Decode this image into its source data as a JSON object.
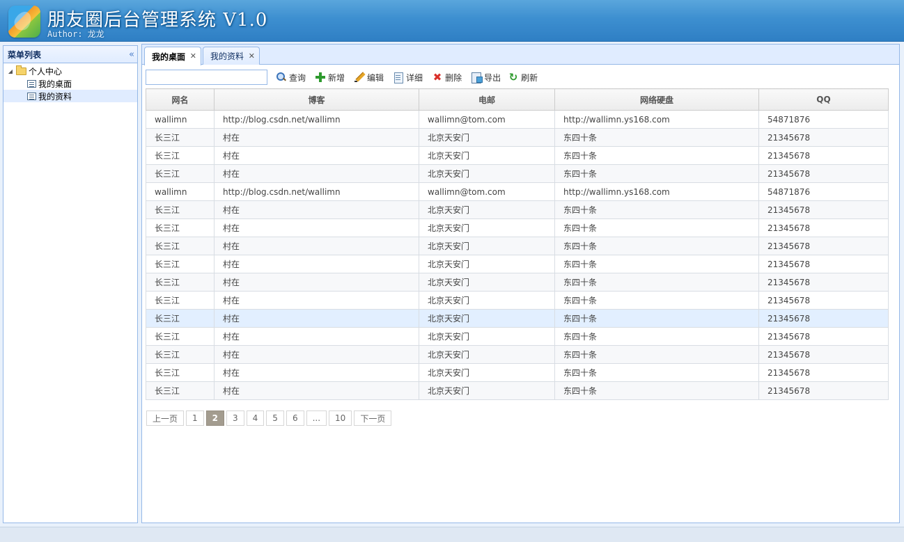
{
  "header": {
    "title": "朋友圈后台管理系统 V1.0",
    "author": "Author: 龙龙",
    "logo_icon": "leaf-logo-icon"
  },
  "sidebar": {
    "title": "菜单列表",
    "collapse_icon": "double-chevron-left-icon",
    "tree": {
      "root_label": "个人中心",
      "items": [
        {
          "label": "我的桌面",
          "selected": false
        },
        {
          "label": "我的资料",
          "selected": true
        }
      ]
    }
  },
  "tabs": [
    {
      "label": "我的桌面",
      "active": true
    },
    {
      "label": "我的资料",
      "active": false
    }
  ],
  "toolbar": {
    "search_value": "",
    "search_label": "查询",
    "add_label": "新增",
    "edit_label": "编辑",
    "detail_label": "详细",
    "delete_label": "删除",
    "export_label": "导出",
    "refresh_label": "刷新"
  },
  "table": {
    "columns": [
      "网名",
      "博客",
      "电邮",
      "网络硬盘",
      "QQ"
    ],
    "rows": [
      [
        "wallimn",
        "http://blog.csdn.net/wallimn",
        "wallimn@tom.com",
        "http://wallimn.ys168.com",
        "54871876"
      ],
      [
        "长三江",
        "村在",
        "北京天安门",
        "东四十条",
        "21345678"
      ],
      [
        "长三江",
        "村在",
        "北京天安门",
        "东四十条",
        "21345678"
      ],
      [
        "长三江",
        "村在",
        "北京天安门",
        "东四十条",
        "21345678"
      ],
      [
        "wallimn",
        "http://blog.csdn.net/wallimn",
        "wallimn@tom.com",
        "http://wallimn.ys168.com",
        "54871876"
      ],
      [
        "长三江",
        "村在",
        "北京天安门",
        "东四十条",
        "21345678"
      ],
      [
        "长三江",
        "村在",
        "北京天安门",
        "东四十条",
        "21345678"
      ],
      [
        "长三江",
        "村在",
        "北京天安门",
        "东四十条",
        "21345678"
      ],
      [
        "长三江",
        "村在",
        "北京天安门",
        "东四十条",
        "21345678"
      ],
      [
        "长三江",
        "村在",
        "北京天安门",
        "东四十条",
        "21345678"
      ],
      [
        "长三江",
        "村在",
        "北京天安门",
        "东四十条",
        "21345678"
      ],
      [
        "长三江",
        "村在",
        "北京天安门",
        "东四十条",
        "21345678"
      ],
      [
        "长三江",
        "村在",
        "北京天安门",
        "东四十条",
        "21345678"
      ],
      [
        "长三江",
        "村在",
        "北京天安门",
        "东四十条",
        "21345678"
      ],
      [
        "长三江",
        "村在",
        "北京天安门",
        "东四十条",
        "21345678"
      ],
      [
        "长三江",
        "村在",
        "北京天安门",
        "东四十条",
        "21345678"
      ]
    ],
    "highlighted_row": 11
  },
  "pager": {
    "prev_label": "上一页",
    "next_label": "下一页",
    "pages": [
      "1",
      "2",
      "3",
      "4",
      "5",
      "6",
      "...",
      "10"
    ],
    "current": "2"
  },
  "colors": {
    "header_blue": "#3d8fd0",
    "panel_border": "#95b8e7",
    "tab_bg": "#e0ecff",
    "row_highlight": "#e2efff",
    "pager_active": "#a39c8f"
  }
}
